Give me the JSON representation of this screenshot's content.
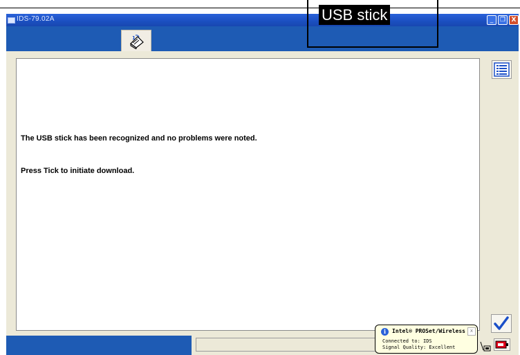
{
  "callout": {
    "label": "USB stick"
  },
  "window": {
    "title": "IDS-79.02A",
    "min_glyph": "_",
    "max_glyph": "❐",
    "close_glyph": "X"
  },
  "header": {
    "tab_icon": "usb-manual-icon"
  },
  "content": {
    "message_recognized": "The USB stick has been recognized and no problems were noted.",
    "message_instruction": "Press Tick to initiate download."
  },
  "side_buttons": {
    "list_icon": "list-icon",
    "tick_icon": "tick-icon"
  },
  "status_bar": {
    "field_value": ""
  },
  "notification": {
    "title": "Intel® PROSet/Wireless",
    "connected": "Connected to: IDS",
    "signal": "Signal Quality: Excellent",
    "close_glyph": "x"
  },
  "colors": {
    "accent_blue": "#1e5bb4",
    "titlebar_blue": "#2a62d9",
    "tick_blue": "#1a4fc8"
  }
}
